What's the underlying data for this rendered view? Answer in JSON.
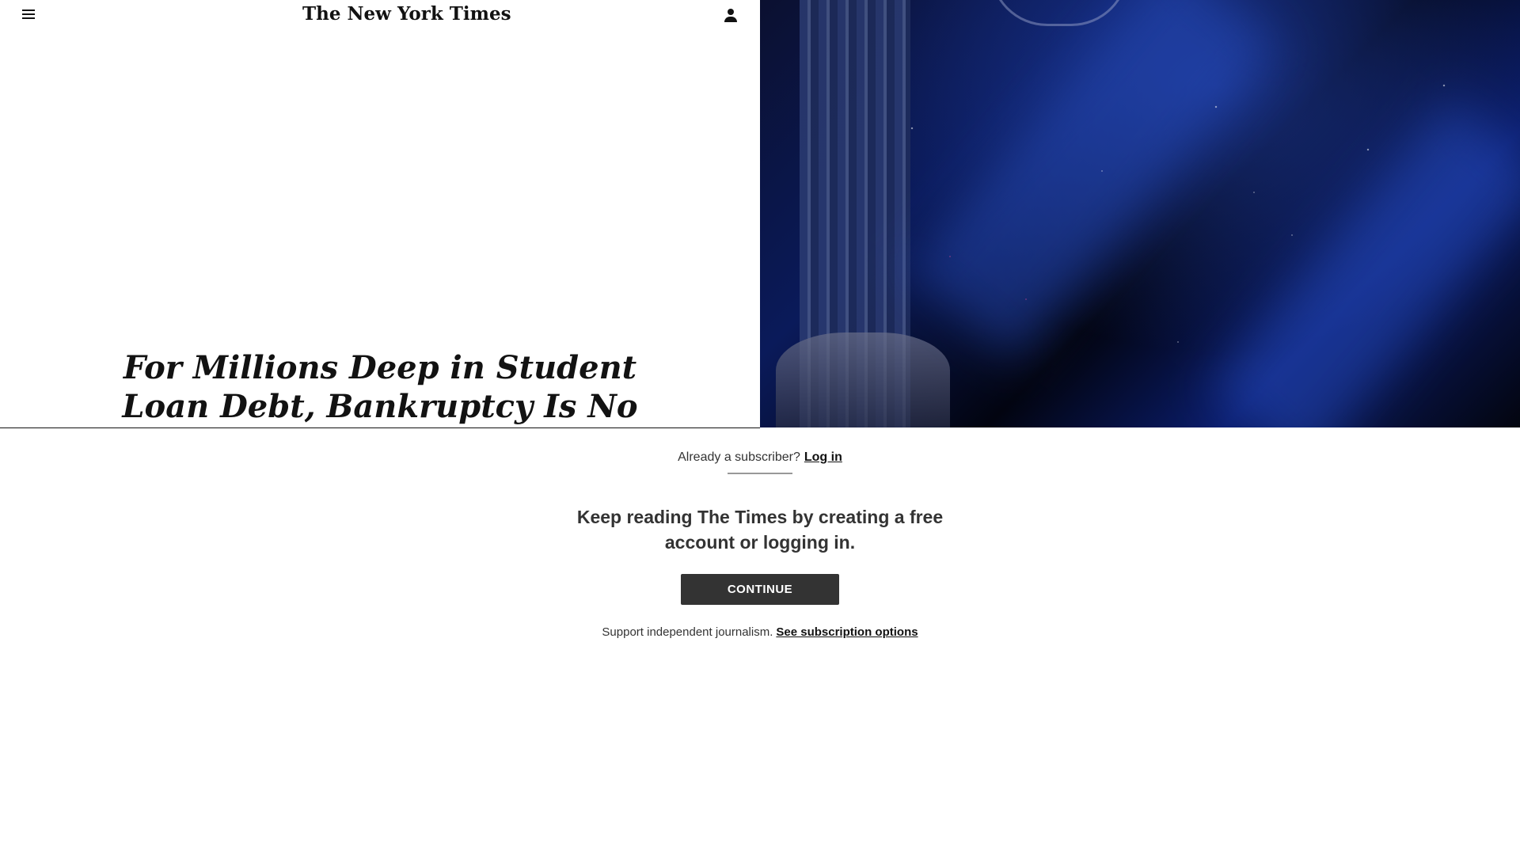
{
  "header": {
    "logo_text": "The New York Times",
    "menu_icon": "hamburger-menu-icon",
    "account_icon": "person-icon"
  },
  "article": {
    "headline": "For Millions Deep in Student Loan Debt, Bankruptcy Is No Easy Fix"
  },
  "gate": {
    "already_subscriber": "Already a subscriber?",
    "login_link": "Log in",
    "keep_reading": "Keep reading The Times by creating a free account or logging in.",
    "continue_button": "CONTINUE",
    "support_text": "Support independent journalism.",
    "subscription_link": "See subscription options"
  },
  "colors": {
    "button_bg": "#333333",
    "text": "#121212"
  }
}
